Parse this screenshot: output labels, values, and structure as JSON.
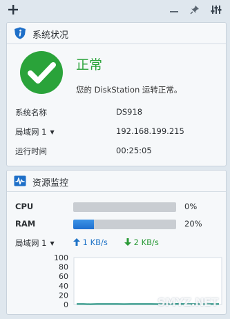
{
  "toolbar": {
    "add_icon": "plus-icon",
    "minimize_icon": "minimize-icon",
    "pin_icon": "pin-icon",
    "settings_icon": "sliders-icon"
  },
  "system_status": {
    "title": "系统状况",
    "icon": "info-shield-icon",
    "status_text": "正常",
    "status_message": "您的 DiskStation 运转正常。",
    "status_color": "#2aa33a",
    "rows": [
      {
        "label": "系统名称",
        "value": "DS918",
        "dropdown": false
      },
      {
        "label": "局域网 1",
        "value": "192.168.199.215",
        "dropdown": true
      },
      {
        "label": "运行时间",
        "value": "00:25:05",
        "dropdown": false
      }
    ]
  },
  "resource_monitor": {
    "title": "资源监控",
    "icon": "pulse-monitor-icon",
    "cpu": {
      "label": "CPU",
      "value_text": "0%",
      "percent": 0
    },
    "ram": {
      "label": "RAM",
      "value_text": "20%",
      "percent": 20
    },
    "network": {
      "label": "局域网 1",
      "upload": "1 KB/s",
      "download": "2 KB/s",
      "upload_color": "#1f73c7",
      "download_color": "#2a9a36"
    }
  },
  "chart_data": {
    "type": "area",
    "title": "",
    "xlabel": "",
    "ylabel": "",
    "ylim": [
      0,
      100
    ],
    "yticks": [
      100,
      80,
      60,
      40,
      20,
      0
    ],
    "grid": false,
    "series": [
      {
        "values": [
          1,
          1,
          0.8,
          1,
          1.2,
          1,
          1,
          0.9,
          1,
          1.1,
          1,
          1,
          0.9,
          1,
          1,
          1.3,
          1,
          1,
          1,
          0.9,
          1,
          1
        ]
      }
    ]
  },
  "watermark": "SMYZ.NET"
}
